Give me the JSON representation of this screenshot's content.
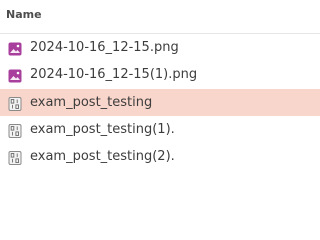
{
  "header": {
    "name_label": "Name"
  },
  "files": [
    {
      "name": "2024-10-16_12-15.png",
      "icon": "image-file-icon",
      "selected": false
    },
    {
      "name": "2024-10-16_12-15(1).png",
      "icon": "image-file-icon",
      "selected": false
    },
    {
      "name": "exam_post_testing",
      "icon": "binary-file-icon",
      "selected": true
    },
    {
      "name": "exam_post_testing(1).",
      "icon": "binary-file-icon",
      "selected": false
    },
    {
      "name": "exam_post_testing(2).",
      "icon": "binary-file-icon",
      "selected": false
    }
  ],
  "colors": {
    "selection": "#f9d6cb",
    "image_icon": "#a93f9c",
    "binary_icon": "#8a8a8a"
  }
}
